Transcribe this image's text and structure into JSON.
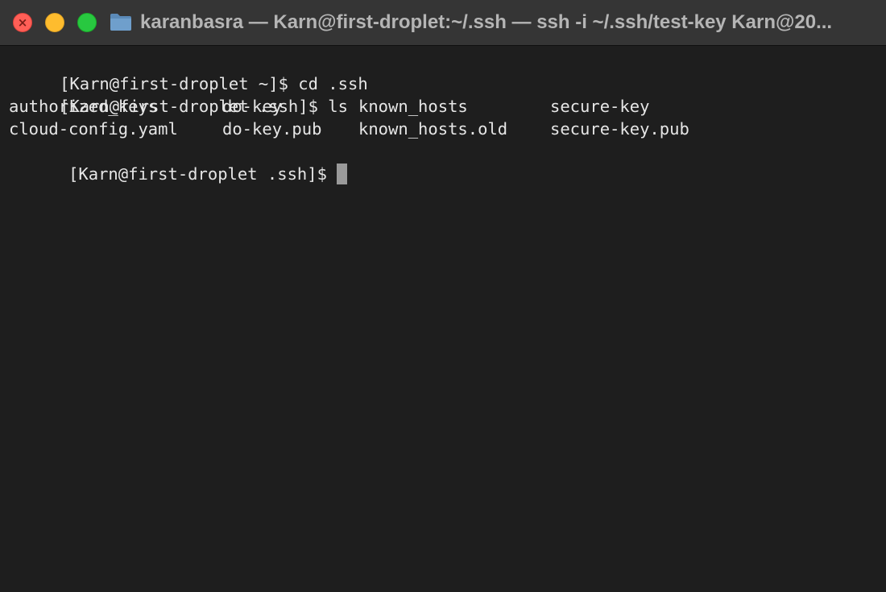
{
  "window": {
    "title": "karanbasra — Karn@first-droplet:~/.ssh — ssh -i ~/.ssh/test-key Karn@20..."
  },
  "terminal": {
    "lines": [
      {
        "bracket": "[",
        "text": "[Karn@first-droplet ~]$ cd .ssh"
      },
      {
        "bracket": "[",
        "text": "[Karn@first-droplet .ssh]$ ls"
      }
    ],
    "ls_output": [
      [
        "authorized_keys",
        "do-key",
        "known_hosts",
        "secure-key"
      ],
      [
        "cloud-config.yaml",
        "do-key.pub",
        "known_hosts.old",
        "secure-key.pub"
      ]
    ],
    "prompt": "[Karn@first-droplet .ssh]$"
  },
  "colors": {
    "background": "#1e1e1e",
    "titlebar": "#353535",
    "text": "#e6e6e6",
    "cursor": "#9a9a9a"
  }
}
